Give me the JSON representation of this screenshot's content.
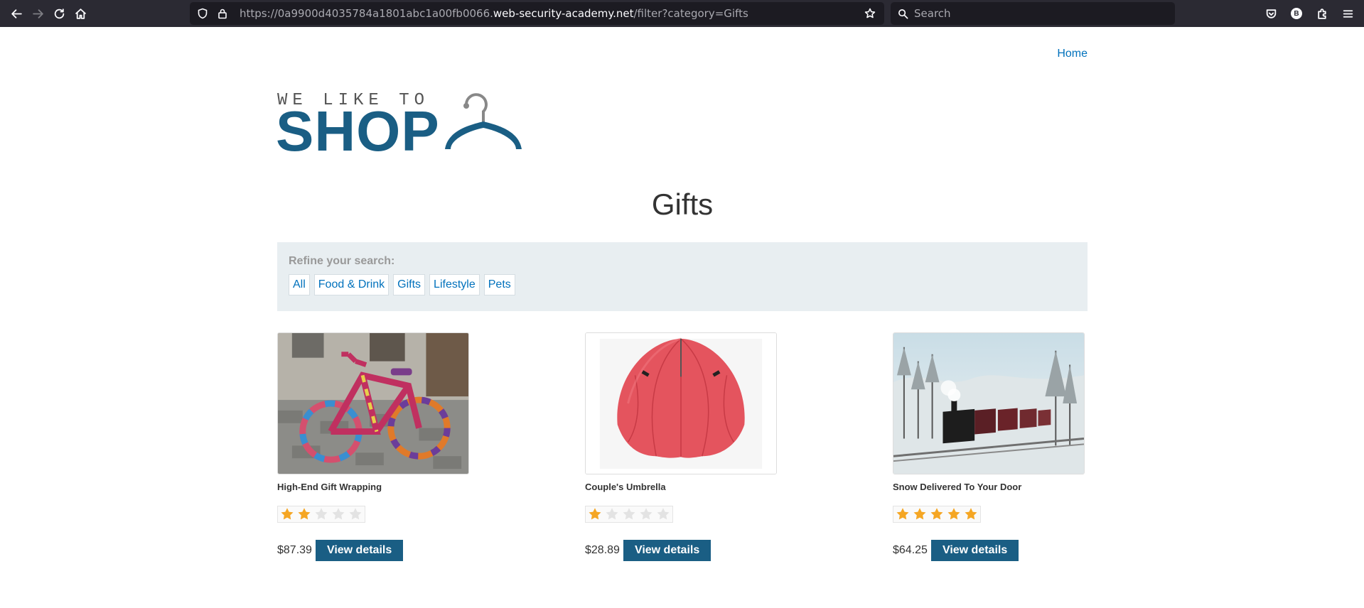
{
  "browser": {
    "url_prefix": "https://0a9900d4035784a1801abc1a00fb0066.",
    "url_host": "web-security-academy.net",
    "url_path": "/filter?category=Gifts",
    "search_placeholder": "Search",
    "account_initial": "B"
  },
  "nav": {
    "home_label": "Home"
  },
  "logo": {
    "small_text": "WE LIKE TO",
    "big_text": "SHOP"
  },
  "page": {
    "title": "Gifts"
  },
  "filter": {
    "label": "Refine your search:",
    "links": [
      "All",
      "Food & Drink",
      "Gifts",
      "Lifestyle",
      "Pets"
    ]
  },
  "products": [
    {
      "name": "High-End Gift Wrapping",
      "rating": 2,
      "price": "$87.39",
      "button_label": "View details"
    },
    {
      "name": "Couple's Umbrella",
      "rating": 1,
      "price": "$28.89",
      "button_label": "View details"
    },
    {
      "name": "Snow Delivered To Your Door",
      "rating": 5,
      "price": "$64.25",
      "button_label": "View details"
    }
  ],
  "colors": {
    "brand_blue": "#1a5e84",
    "link_blue": "#0071bc",
    "star_filled": "#f5a623",
    "star_empty": "#e3e3e3",
    "filter_bg": "#e8eef1"
  },
  "icons": [
    "back-icon",
    "forward-icon",
    "reload-icon",
    "home-icon",
    "shield-icon",
    "lock-icon",
    "bookmark-star-icon",
    "search-icon",
    "pocket-icon",
    "account-icon",
    "extensions-icon",
    "menu-icon",
    "hanger-icon",
    "star-icon"
  ]
}
